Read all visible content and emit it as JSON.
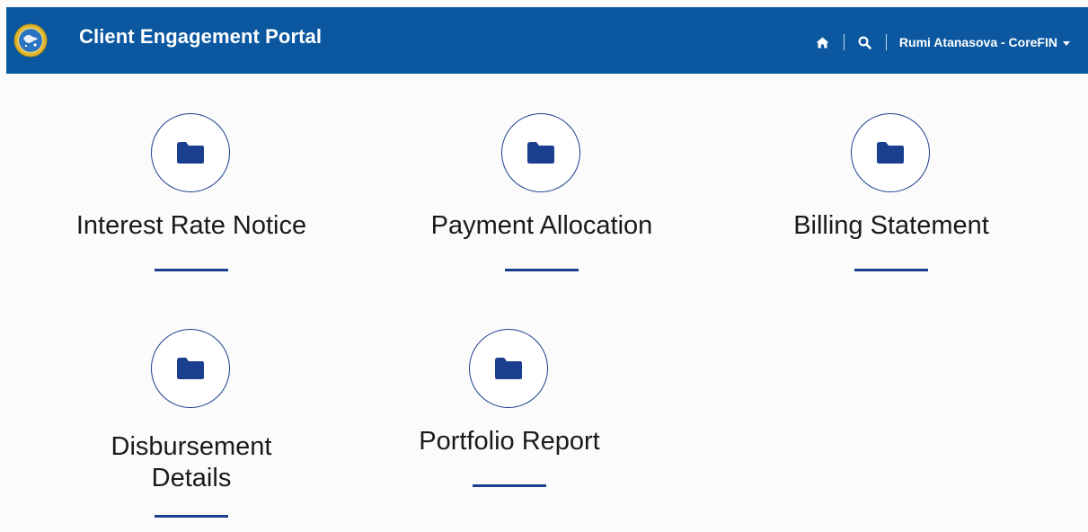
{
  "header": {
    "title": "Client Engagement Portal",
    "user_menu_label": "Rumi Atanasova - CoreFIN",
    "icons": {
      "logo": "organization-seal-logo",
      "home": "home-icon",
      "search": "search-icon",
      "dropdown": "caret-down-icon"
    },
    "colors": {
      "header_background": "#0b58a0",
      "accent": "#1b3f8f"
    }
  },
  "tiles": [
    {
      "label": "Interest Rate Notice",
      "icon": "folder-icon"
    },
    {
      "label": "Payment Allocation",
      "icon": "folder-icon"
    },
    {
      "label": "Billing Statement",
      "icon": "folder-icon"
    },
    {
      "label": "Disbursement Details",
      "icon": "folder-icon"
    },
    {
      "label": "Portfolio Report",
      "icon": "folder-icon"
    }
  ]
}
